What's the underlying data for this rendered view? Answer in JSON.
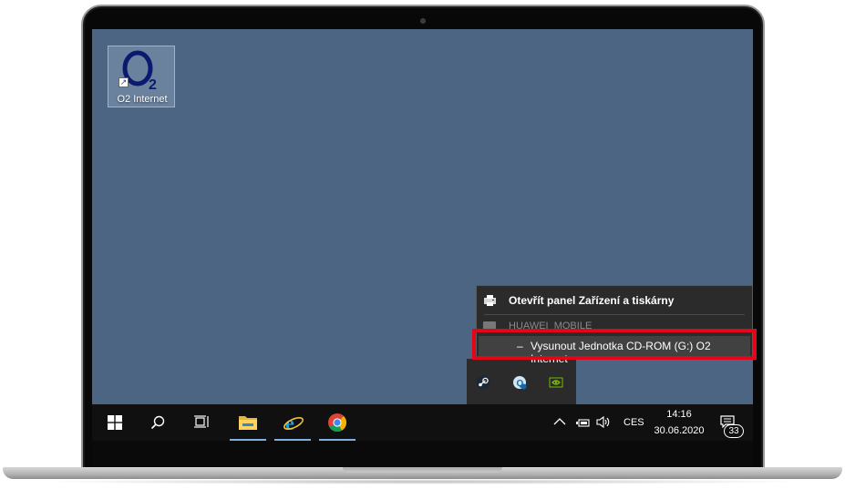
{
  "desktop": {
    "background_color": "#4b6582",
    "icon": {
      "logo_text": "O",
      "logo_sub": "2",
      "label": "O2 Internet"
    }
  },
  "context_menu": {
    "open_devices_label": "Otevřít panel Zařízení a tiskárny",
    "device_name": "HUAWEI_MOBILE",
    "eject_prefix": "–",
    "eject_label": "Vysunout Jednotka CD-ROM (G:) O2 Internet"
  },
  "tray_overflow": {
    "icons": [
      "steam-icon",
      "lenovo-vantage-icon",
      "nvidia-icon"
    ]
  },
  "taskbar": {
    "pinned": [
      "start-button",
      "search-button",
      "task-view-button",
      "file-explorer",
      "internet-explorer",
      "google-chrome"
    ],
    "language": "CES",
    "time": "14:16",
    "date": "30.06.2020",
    "notification_count": "33"
  },
  "colors": {
    "accent_highlight": "#e3061b",
    "taskbar": "#101010",
    "menu_bg": "#2b2b2b",
    "o2_blue": "#0b1a6e"
  }
}
